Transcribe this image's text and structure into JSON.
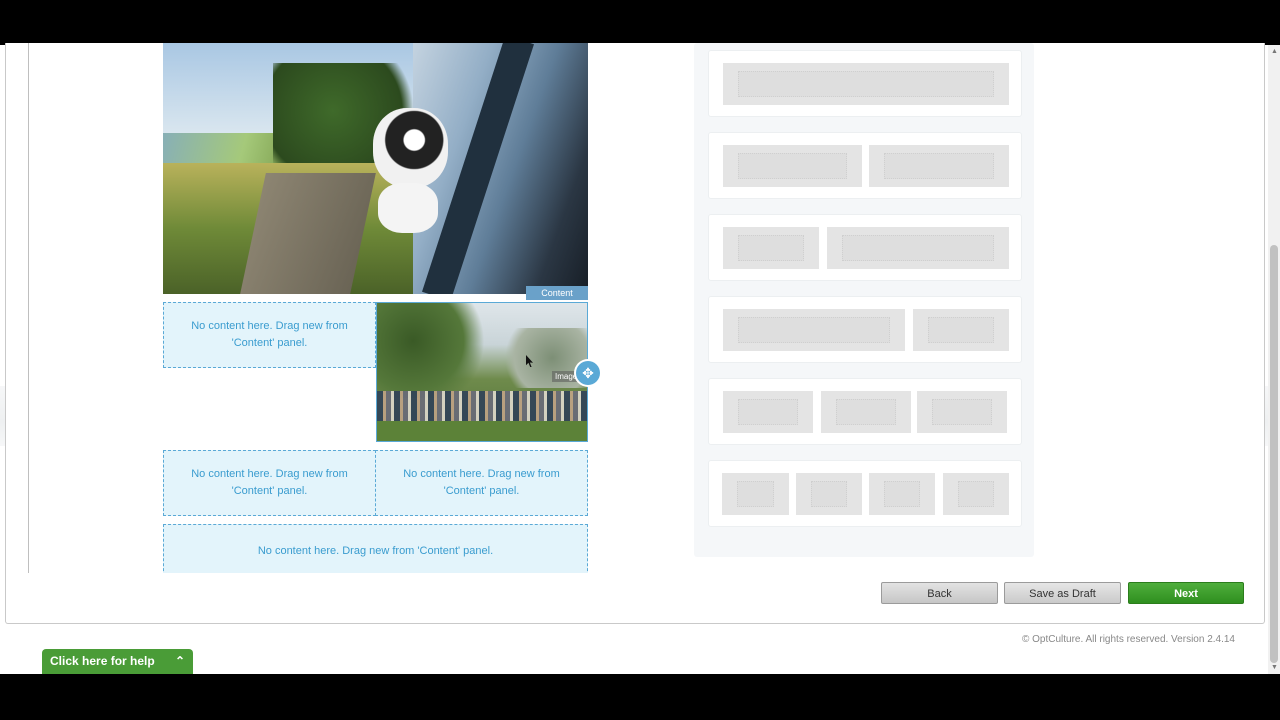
{
  "canvas": {
    "content_tag": "Content",
    "image_tag": "Image",
    "move_handle_glyph": "✥",
    "drop_zones": {
      "left_of_image": "No content here. Drag new from 'Content' panel.",
      "two_col_left": "No content here. Drag new from 'Content' panel.",
      "two_col_right": "No content here. Drag new from 'Content' panel.",
      "full_width": "No content here. Drag new from 'Content' panel."
    }
  },
  "buttons": {
    "back": "Back",
    "save_as_draft": "Save as Draft",
    "next": "Next"
  },
  "footer": {
    "copyright": "© OptCulture. All rights reserved. Version 2.4.14"
  },
  "help": {
    "label": "Click here for help",
    "chevron": "⌃"
  },
  "scrollbar": {
    "up": "▲",
    "down": "▼"
  },
  "colors": {
    "accent_blue": "#5aa9d6",
    "next_green": "#3b9e2a",
    "help_green": "#4a9c37"
  }
}
